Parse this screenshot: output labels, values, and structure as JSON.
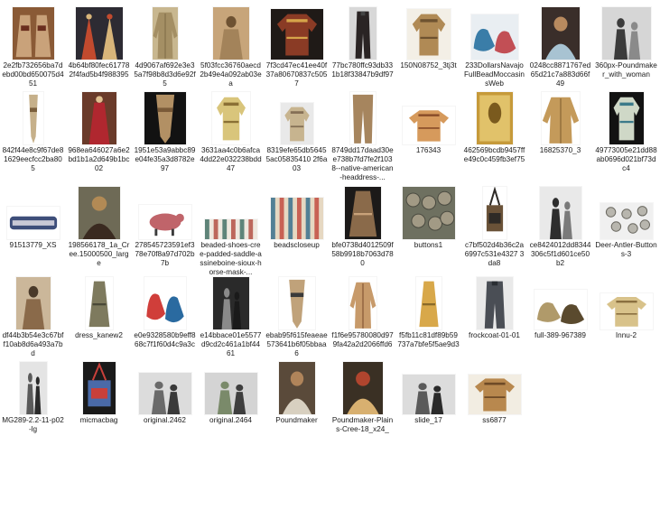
{
  "files": [
    {
      "name": "2e2fb732656ba7debd00bd650075d451",
      "type": "garment-pair-image"
    },
    {
      "name": "4b64bf80fec617782f4fad5b4f988395",
      "type": "dolls-image"
    },
    {
      "name": "4d9067af692e3e35a7f98b8d3d6e92f5",
      "type": "coat-image"
    },
    {
      "name": "5f03fcc36760aecd2b49e4a092ab03ea",
      "type": "sepia-photo-image"
    },
    {
      "name": "7f3cd47ec41ee40f37a80670837c5057",
      "type": "beaded-shirt-image"
    },
    {
      "name": "77bc780ffc93db331b18f33847b9df97",
      "type": "frockcoat-image"
    },
    {
      "name": "150N08752_3tj3t",
      "type": "tan-shirt-image"
    },
    {
      "name": "233DollarsNavajoFullBeadMoccasinsWeb",
      "type": "moccasins-image"
    },
    {
      "name": "0248cc8871767ed65d21c7a883d66f49",
      "type": "portrait-image"
    },
    {
      "name": "360px-Poundmaker_with_woman",
      "type": "bw-photo-image"
    },
    {
      "name": "842f44e8c9f67de81629eecfcc2ba805",
      "type": "knife-sheath-image"
    },
    {
      "name": "968ea646027a6e2bd1b1a2d649b1bc02",
      "type": "red-garment-image"
    },
    {
      "name": "1951e53a9abbc89e04fe35a3d8782e97",
      "type": "sheath-image"
    },
    {
      "name": "3631aa4c0b6afca4dd22e032238bdd47",
      "type": "buckskin-shirt-image"
    },
    {
      "name": "8319efe65db56455ac05835410 2f6a03",
      "type": "small-shirt-image"
    },
    {
      "name": "8749dd17daad30ee738b7fd7fe2f1038--native-american-headdress-...",
      "type": "leggings-image"
    },
    {
      "name": "176343",
      "type": "orange-jacket-image"
    },
    {
      "name": "462569bcdb9457ffe49c0c459fb3ef75",
      "type": "gold-card-image"
    },
    {
      "name": "16825370_3",
      "type": "fringed-coat-image"
    },
    {
      "name": "49773005e21dd88ab0696d021bf73dc4",
      "type": "floral-shirt-image"
    },
    {
      "name": "91513779_XS",
      "type": "beaded-strip-image"
    },
    {
      "name": "198566178_1a_Cree.15000500_large",
      "type": "painted-portrait-image"
    },
    {
      "name": "278545723591ef378e70f8a97d702b7b",
      "type": "beaded-animal-image"
    },
    {
      "name": "beaded-shoes-cree-padded-saddle-assineboine-sioux-horse-mask-...",
      "type": "beaded-items-image"
    },
    {
      "name": "beadscloseup",
      "type": "beads-image"
    },
    {
      "name": "bfe0738d4012509f58b9918b7063d780",
      "type": "dress-mannequin-image"
    },
    {
      "name": "buttons1",
      "type": "buttons-image"
    },
    {
      "name": "c7bf502d4b36c2a6997c531e4327 3da8",
      "type": "bag-image"
    },
    {
      "name": "ce8424012dd8344306c5f1d601ce50b2",
      "type": "bw-portrait-image"
    },
    {
      "name": "Deer-Antler-Buttons-3",
      "type": "antler-buttons-image"
    },
    {
      "name": "df44b3b54e3c67bff10ab8d6a493a7bd",
      "type": "sepia-man-image"
    },
    {
      "name": "dress_kanew2",
      "type": "dress-image"
    },
    {
      "name": "e0e9328580b9eff868c7f1f60d4c9a3c",
      "type": "beaded-shoes-image"
    },
    {
      "name": "e14bbace01e5577d9cd2c461a1bf4461",
      "type": "bw-woman-image"
    },
    {
      "name": "ebab95f615feaeae573641b6f05bbaa6",
      "type": "quilled-sheath-image"
    },
    {
      "name": "f1f6e95780080d979fa42a2d2066ffd6",
      "type": "long-coat-image"
    },
    {
      "name": "f5fb11c81df89b59737a7bfe5f5ae9d3",
      "type": "gold-dress-image"
    },
    {
      "name": "frockcoat-01-01",
      "type": "grey-frockcoat-image"
    },
    {
      "name": "full-389-967389",
      "type": "moccasin-pair-image"
    },
    {
      "name": "Innu-2",
      "type": "innu-coat-image"
    },
    {
      "name": "MG289-2.2-11-p02-lg",
      "type": "bw-standing-image"
    },
    {
      "name": "micmacbag",
      "type": "micmac-bag-image"
    },
    {
      "name": "original.2462",
      "type": "bw-group-image"
    },
    {
      "name": "original.2464",
      "type": "bw-crowd-image"
    },
    {
      "name": "Poundmaker",
      "type": "poundmaker-image"
    },
    {
      "name": "Poundmaker-Plains-Cree-18_x24_",
      "type": "painted-chief-image"
    },
    {
      "name": "slide_17",
      "type": "slide-photo-image"
    },
    {
      "name": "ss6877",
      "type": "tan-coat-image"
    }
  ],
  "colors": {
    "background": "#ffffff",
    "label_text": "#1a1a1a"
  }
}
